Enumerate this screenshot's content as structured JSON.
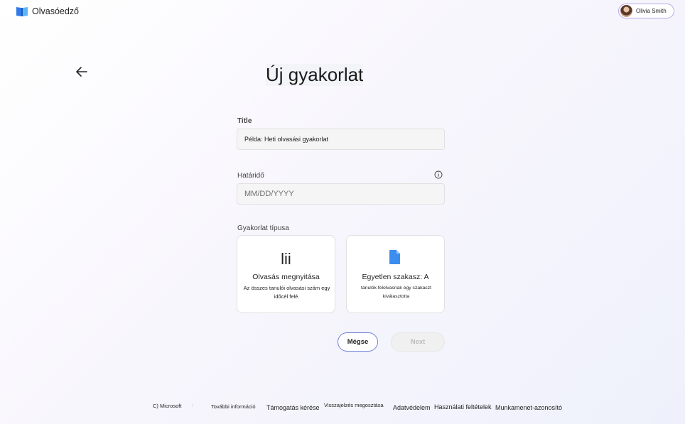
{
  "app": {
    "name": "Olvasóedző"
  },
  "user": {
    "name": "Olivia Smith"
  },
  "page": {
    "title": "Új gyakorlat"
  },
  "form": {
    "title_label": "Title",
    "title_placeholder": "Példa: Heti olvasási gyakorlat",
    "due_label": "Határidő",
    "due_placeholder": "MM/DD/YYYY",
    "type_label": "Gyakorlat típusa"
  },
  "types": [
    {
      "icon": "lii",
      "title": "Olvasás megnyitása",
      "description": "Az összes tanulói olvasási szám egy időcél felé."
    },
    {
      "icon": "document-icon",
      "title": "Egyetlen szakasz: A",
      "description": "tanulók felolvasnak egy szakaszt kiválasztotta"
    }
  ],
  "buttons": {
    "cancel": "Mégse",
    "next": "Next"
  },
  "footer": {
    "copyright": "C) Microsoft",
    "separator": ":",
    "more_info": "További információ",
    "support": "Támogatás kérése",
    "feedback": "Visszajelzés megosztása",
    "privacy": "Adatvédelem",
    "terms": "Használati feltételek",
    "session": "Munkamenet-azonosító"
  },
  "colors": {
    "accent": "#6d7fd6",
    "brand_blue": "#3b82f6",
    "pill_border": "#b9a6e8"
  }
}
